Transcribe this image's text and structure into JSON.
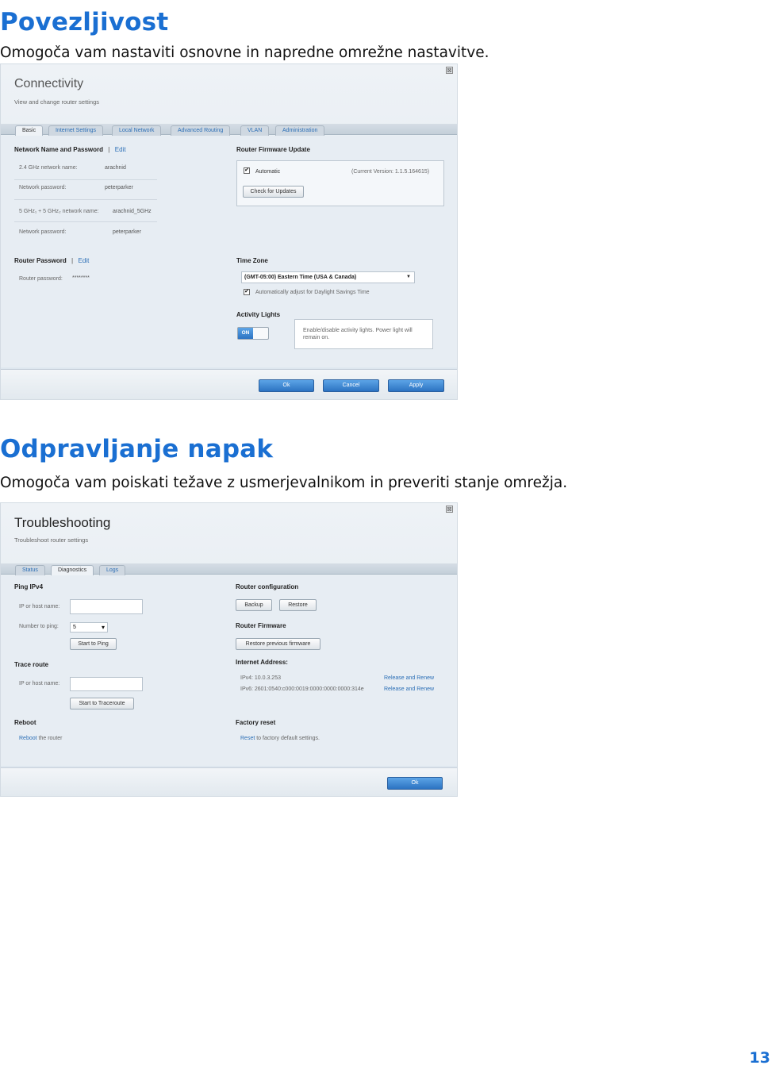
{
  "sections": [
    {
      "heading": "Povezljivost",
      "description": "Omogoča vam nastaviti osnovne in napredne omrežne nastavitve."
    },
    {
      "heading": "Odpravljanje napak",
      "description": "Omogoča vam poiskati težave z usmerjevalnikom in preveriti stanje omrežja."
    }
  ],
  "page_number": "13",
  "connectivity": {
    "close": "⊠",
    "title": "Connectivity",
    "subtitle": "View and change router settings",
    "tabs": [
      "Basic",
      "Internet Settings",
      "Local Network",
      "Advanced Routing",
      "VLAN",
      "Administration"
    ],
    "network": {
      "heading": "Network Name and Password",
      "divider": "|",
      "edit": "Edit",
      "name24_label": "2.4 GHz network name:",
      "name24_value": "arachnid",
      "pw1_label": "Network password:",
      "pw1_value": "peterparker",
      "name5_label": "5 GHz₁ + 5 GHz₂ network name:",
      "name5_value": "arachnid_5GHz",
      "pw2_label": "Network password:",
      "pw2_value": "peterparker"
    },
    "router_password": {
      "heading": "Router Password",
      "divider": "|",
      "edit": "Edit",
      "label": "Router password:",
      "value": "********"
    },
    "firmware": {
      "heading": "Router Firmware Update",
      "check": "✔",
      "automatic": "Automatic",
      "version": "(Current Version: 1.1.5.164615)",
      "check_button": "Check for Updates"
    },
    "timezone": {
      "heading": "Time Zone",
      "selected": "(GMT-05:00) Eastern Time (USA & Canada)",
      "arrow": "▼",
      "check": "✔",
      "dst": "Automatically adjust for Daylight Savings Time"
    },
    "lights": {
      "heading": "Activity Lights",
      "toggle": "ON",
      "note": "Enable/disable activity lights. Power light will remain on."
    },
    "buttons": {
      "ok": "Ok",
      "cancel": "Cancel",
      "apply": "Apply"
    }
  },
  "troubleshooting": {
    "close": "⊠",
    "title": "Troubleshooting",
    "subtitle": "Troubleshoot router settings",
    "tabs": [
      "Status",
      "Diagnostics",
      "Logs"
    ],
    "ping": {
      "heading": "Ping IPv4",
      "host_label": "IP or host name:",
      "count_label": "Number to ping:",
      "count_value": "5",
      "count_arrow": "▾",
      "start_button": "Start to Ping"
    },
    "trace": {
      "heading": "Trace route",
      "host_label": "IP or host name:",
      "start_button": "Start to Traceroute"
    },
    "reboot": {
      "heading": "Reboot",
      "link": "Reboot",
      "text": " the router"
    },
    "router_config": {
      "heading": "Router configuration",
      "backup": "Backup",
      "restore": "Restore"
    },
    "router_firmware": {
      "heading": "Router Firmware",
      "restore_prev": "Restore previous firmware"
    },
    "internet_address": {
      "heading": "Internet Address:",
      "ipv4": "IPv4: 10.0.3.253",
      "ipv6": "IPv6: 2601:0540:c000:0019:0000:0000:0000:314e",
      "release1": "Release and Renew",
      "release2": "Release and Renew"
    },
    "factory": {
      "heading": "Factory reset",
      "link": "Reset",
      "text": " to factory default settings."
    },
    "buttons": {
      "ok": "Ok"
    }
  }
}
